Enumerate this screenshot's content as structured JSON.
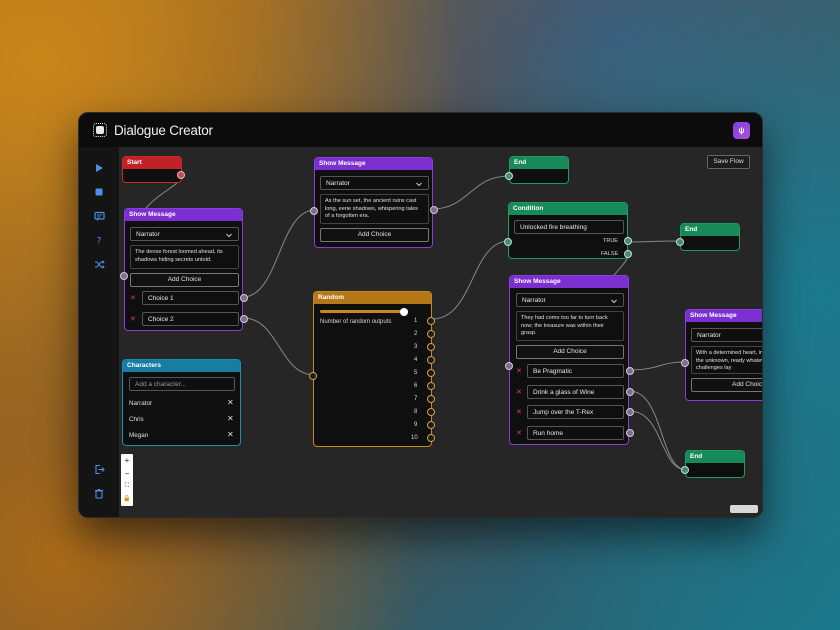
{
  "app": {
    "title": "Dialogue Creator",
    "avatar_initial": "ψ"
  },
  "toolbar": {
    "save_flow": "Save Flow"
  },
  "zoom": {
    "plus": "+",
    "minus": "−",
    "fit": "⛶",
    "lock": "🔒"
  },
  "nodes": {
    "start": {
      "title": "Start"
    },
    "show1": {
      "title": "Show Message",
      "character": "Narrator",
      "message": "The dense forest loomed ahead, its shadows hiding secrets untold.",
      "add_choice": "Add Choice",
      "choices": [
        "Choice 1",
        "Choice 2"
      ]
    },
    "characters": {
      "title": "Characters",
      "placeholder": "Add a character...",
      "list": [
        "Narrator",
        "Chris",
        "Megan"
      ]
    },
    "show2": {
      "title": "Show Message",
      "character": "Narrator",
      "message": "As the sun set, the ancient ruins cast long, eerie shadows, whispering tales of a forgotten era.",
      "add_choice": "Add Choice"
    },
    "random": {
      "title": "Random",
      "label": "Number of random outputs",
      "outputs": [
        "1",
        "2",
        "3",
        "4",
        "5",
        "6",
        "7",
        "8",
        "9",
        "10"
      ],
      "slider_fraction": 0.96
    },
    "end1": {
      "title": "End"
    },
    "condition": {
      "title": "Condition",
      "condition": "Unlocked fire breathing",
      "true_label": "TRUE",
      "false_label": "FALSE"
    },
    "end2": {
      "title": "End"
    },
    "show3": {
      "title": "Show Message",
      "character": "Narrator",
      "message": "They had come too far to turn back now; the treasure was within their grasp.",
      "add_choice": "Add Choice",
      "choices": [
        "Be Pragmatic",
        "Drink a glass of Wine",
        "Jump over the T-Rex",
        "Run home"
      ]
    },
    "show4": {
      "title": "Show Message",
      "character": "Narrator",
      "message": "With a determined heart, into the unknown, ready whatever challenges lay",
      "add_choice": "Add Choic"
    },
    "end3": {
      "title": "End"
    }
  },
  "colors": {
    "purple": "#7b2fd0",
    "green": "#188a5a",
    "red": "#c22128",
    "teal": "#167ea3",
    "gold": "#b57818",
    "canvas": "#262626"
  },
  "icons": {
    "sidebar": [
      "play-icon",
      "stop-icon",
      "message-icon",
      "help-icon",
      "shuffle-icon",
      "export-icon",
      "trash-icon"
    ]
  }
}
